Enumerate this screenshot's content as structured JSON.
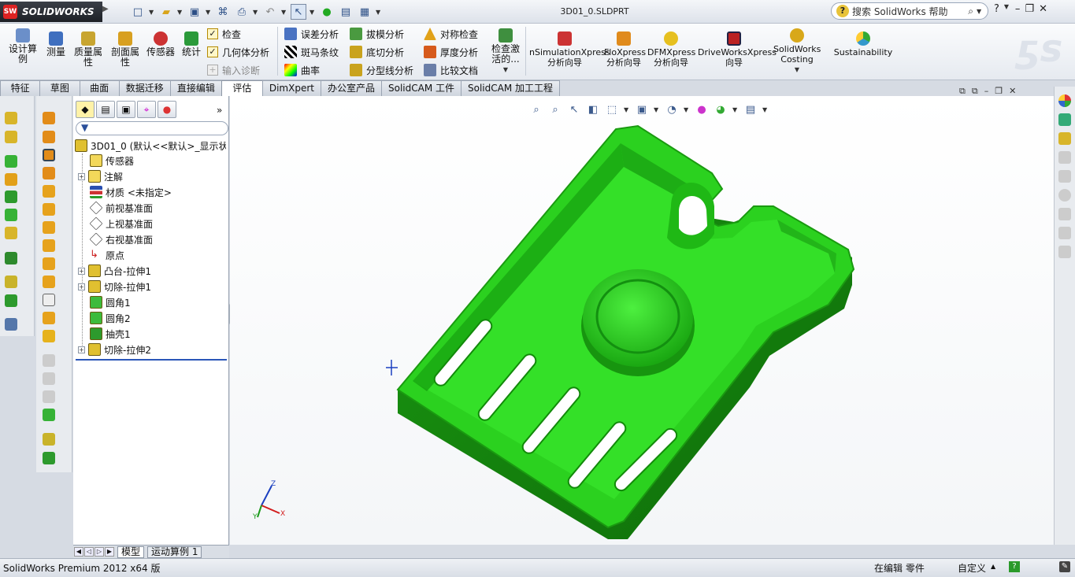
{
  "app": {
    "brand": "SOLIDWORKS",
    "brand_mark": "SW",
    "document_title": "3D01_0.SLDPRT"
  },
  "help_search": {
    "placeholder": "搜索 SolidWorks 帮助"
  },
  "ribbon": {
    "big_buttons": [
      {
        "label": "设计算例"
      },
      {
        "label": "测量"
      },
      {
        "label": "质量属性"
      },
      {
        "label": "剖面属性"
      },
      {
        "label": "传感器"
      },
      {
        "label": "统计"
      }
    ],
    "small_col1": [
      {
        "label": "检查"
      },
      {
        "label": "几何体分析"
      },
      {
        "label": "输入诊断"
      }
    ],
    "small_col2": [
      {
        "label": "误差分析"
      },
      {
        "label": "斑马条纹"
      },
      {
        "label": "曲率"
      }
    ],
    "small_col3": [
      {
        "label": "拔模分析"
      },
      {
        "label": "底切分析"
      },
      {
        "label": "分型线分析"
      }
    ],
    "small_col4": [
      {
        "label": "对称检查"
      },
      {
        "label": "厚度分析"
      },
      {
        "label": "比较文档"
      }
    ],
    "check_active": {
      "label": "检查激活的..."
    },
    "addins": [
      {
        "label": "nSimulationXpress分析向导"
      },
      {
        "label": "FloXpress分析向导"
      },
      {
        "label": "DFMXpress分析向导"
      },
      {
        "label": "DriveWorksXpress向导"
      },
      {
        "label": "SolidWorks Costing"
      },
      {
        "label": "Sustainability"
      }
    ]
  },
  "tabs": [
    "特征",
    "草图",
    "曲面",
    "数据迁移",
    "直接编辑",
    "评估",
    "DimXpert",
    "办公室产品",
    "SolidCAM 工件",
    "SolidCAM 加工工程"
  ],
  "active_tab": "评估",
  "feature_tree": {
    "root": "3D01_0 (默认<<默认>_显示状态",
    "items": [
      {
        "label": "传感器"
      },
      {
        "label": "注解"
      },
      {
        "label": "材质 <未指定>"
      },
      {
        "label": "前视基准面"
      },
      {
        "label": "上视基准面"
      },
      {
        "label": "右视基准面"
      },
      {
        "label": "原点"
      },
      {
        "label": "凸台-拉伸1"
      },
      {
        "label": "切除-拉伸1"
      },
      {
        "label": "圆角1"
      },
      {
        "label": "圆角2"
      },
      {
        "label": "抽壳1"
      },
      {
        "label": "切除-拉伸2"
      }
    ]
  },
  "bottom_tabs": [
    "模型",
    "运动算例 1"
  ],
  "status": {
    "left": "SolidWorks Premium 2012 x64 版",
    "editing": "在编辑 零件",
    "custom": "自定义"
  },
  "colors": {
    "model_green": "#2bd11f",
    "model_dark": "#157a0e",
    "viewport_bg": "#ffffff"
  },
  "triad": {
    "x": "X",
    "y": "Y",
    "z": "Z"
  }
}
